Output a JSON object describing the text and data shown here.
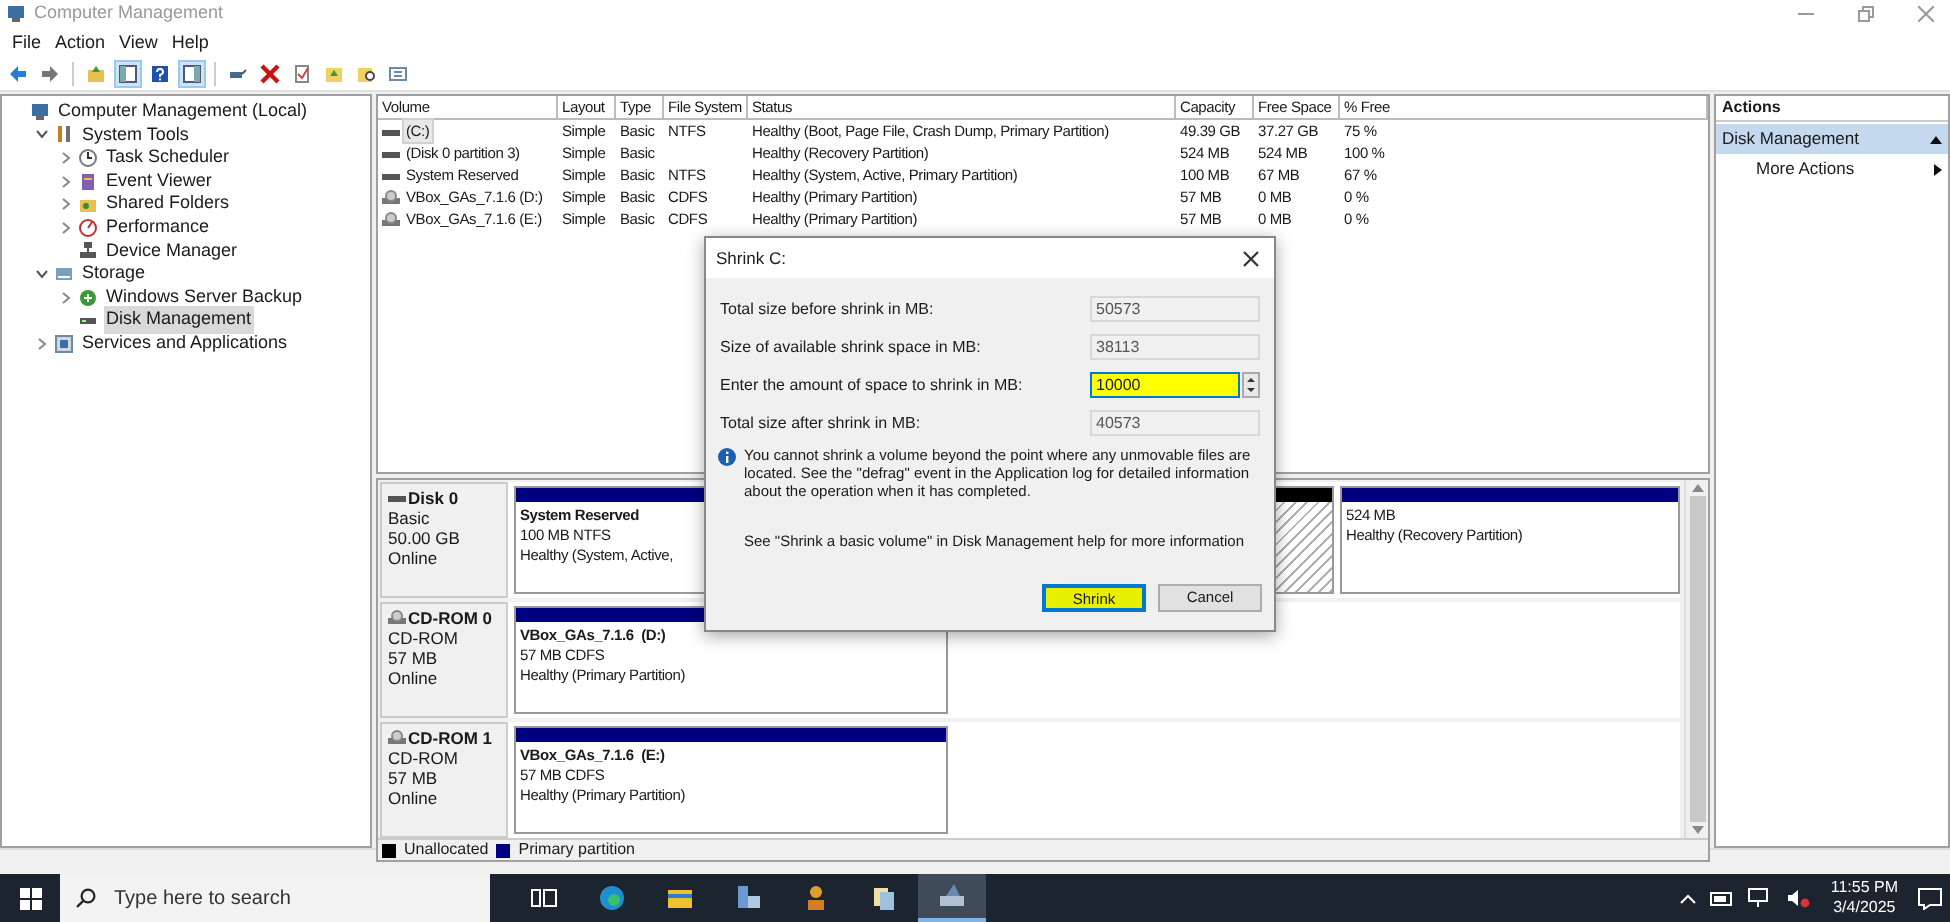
{
  "window": {
    "title": "Computer Management"
  },
  "menu": [
    "File",
    "Action",
    "View",
    "Help"
  ],
  "toolbar": [
    {
      "pressed": false
    },
    {
      "pressed": false
    },
    {
      "pressed": false
    },
    {
      "pressed": true
    },
    {
      "pressed": false
    },
    {
      "pressed": true
    },
    {
      "pressed": false
    },
    {
      "pressed": false
    },
    {
      "pressed": false
    },
    {
      "pressed": false
    },
    {
      "pressed": false
    },
    {
      "pressed": false
    }
  ],
  "tree": [
    {
      "label": "Computer Management (Local)",
      "kind": "plain",
      "selected": false,
      "children": [
        {
          "label": "System Tools",
          "kind": "node",
          "expanded": true,
          "selected": false,
          "children": [
            {
              "label": "Task Scheduler",
              "kind": "node",
              "expanded": false,
              "selected": false
            },
            {
              "label": "Event Viewer",
              "kind": "node",
              "expanded": false,
              "selected": false
            },
            {
              "label": "Shared Folders",
              "kind": "node",
              "expanded": false,
              "selected": false
            },
            {
              "label": "Performance",
              "kind": "node",
              "expanded": false,
              "selected": false
            },
            {
              "label": "Device Manager",
              "kind": "plain",
              "selected": false
            }
          ]
        },
        {
          "label": "Storage",
          "kind": "node",
          "expanded": true,
          "selected": false,
          "children": [
            {
              "label": "Windows Server Backup",
              "kind": "node",
              "expanded": false,
              "selected": false
            },
            {
              "label": "Disk Management",
              "kind": "plain",
              "selected": true
            }
          ]
        },
        {
          "label": "Services and Applications",
          "kind": "node",
          "expanded": false,
          "selected": false
        }
      ]
    }
  ],
  "volumes": {
    "columns": [
      "Volume",
      "Layout",
      "Type",
      "File System",
      "Status",
      "Capacity",
      "Free Space",
      "% Free"
    ],
    "rows": [
      {
        "kind": "disk",
        "selected": true,
        "cells": [
          "(C:)",
          "Simple",
          "Basic",
          "NTFS",
          "Healthy (Boot, Page File, Crash Dump, Primary Partition)",
          "49.39 GB",
          "37.27 GB",
          "75 %"
        ]
      },
      {
        "kind": "disk",
        "selected": false,
        "cells": [
          "(Disk 0 partition 3)",
          "Simple",
          "Basic",
          "",
          "Healthy (Recovery Partition)",
          "524 MB",
          "524 MB",
          "100 %"
        ]
      },
      {
        "kind": "disk",
        "selected": false,
        "cells": [
          "System Reserved",
          "Simple",
          "Basic",
          "NTFS",
          "Healthy (System, Active, Primary Partition)",
          "100 MB",
          "67 MB",
          "67 %"
        ]
      },
      {
        "kind": "cdrom",
        "selected": false,
        "cells": [
          "VBox_GAs_7.1.6 (D:)",
          "Simple",
          "Basic",
          "CDFS",
          "Healthy (Primary Partition)",
          "57 MB",
          "0 MB",
          "0 %"
        ]
      },
      {
        "kind": "cdrom",
        "selected": false,
        "cells": [
          "VBox_GAs_7.1.6 (E:)",
          "Simple",
          "Basic",
          "CDFS",
          "Healthy (Primary Partition)",
          "57 MB",
          "0 MB",
          "0 %"
        ]
      }
    ]
  },
  "disks": [
    {
      "kind": "disk",
      "name": "Disk 0",
      "lines": [
        "Basic",
        "50.00 GB",
        "Online"
      ],
      "partitions": [
        {
          "kind": "primary",
          "name": "System Reserved",
          "lines": [
            "100 MB NTFS",
            "Healthy (System, Active,"
          ]
        },
        {
          "kind": "unallocated"
        },
        {
          "kind": "primary",
          "lines": [
            "524 MB",
            "Healthy (Recovery Partition)"
          ]
        }
      ]
    },
    {
      "kind": "cdrom",
      "name": "CD-ROM 0",
      "lines": [
        "CD-ROM",
        "57 MB",
        "Online"
      ],
      "partitions": [
        {
          "kind": "primary",
          "name": "VBox_GAs_7.1.6  (D:)",
          "lines": [
            "57 MB CDFS",
            "Healthy (Primary Partition)"
          ]
        }
      ]
    },
    {
      "kind": "cdrom",
      "name": "CD-ROM 1",
      "lines": [
        "CD-ROM",
        "57 MB",
        "Online"
      ],
      "partitions": [
        {
          "kind": "primary",
          "name": "VBox_GAs_7.1.6  (E:)",
          "lines": [
            "57 MB CDFS",
            "Healthy (Primary Partition)"
          ]
        }
      ]
    }
  ],
  "legend": [
    {
      "label": "Unallocated",
      "color": "#000000"
    },
    {
      "label": "Primary partition",
      "color": "#000080"
    }
  ],
  "actions": {
    "title": "Actions",
    "section": "Disk Management",
    "items": [
      "More Actions"
    ]
  },
  "dialog": {
    "title": "Shrink C:",
    "fields": [
      {
        "kind": "readonly",
        "label": "Total size before shrink in MB:",
        "value": "50573"
      },
      {
        "kind": "readonly",
        "label": "Size of available shrink space in MB:",
        "value": "38113"
      },
      {
        "kind": "input",
        "label": "Enter the amount of space to shrink in MB:",
        "value": "10000",
        "highlighted": true
      },
      {
        "kind": "readonly",
        "label": "Total size after shrink in MB:",
        "value": "40573"
      }
    ],
    "info": "You cannot shrink a volume beyond the point where any unmovable files are located. See the \"defrag\" event in the Application log for detailed information about the operation when it has completed.",
    "help": "See \"Shrink a basic volume\" in Disk Management help for more information",
    "buttons": [
      {
        "label": "Shrink",
        "default": true,
        "highlighted": true
      },
      {
        "label": "Cancel",
        "default": false,
        "highlighted": false
      }
    ]
  },
  "taskbar": {
    "search_placeholder": "Type here to search",
    "apps": [
      {
        "selected": false
      },
      {
        "selected": false
      },
      {
        "selected": false
      },
      {
        "selected": false
      },
      {
        "selected": false
      },
      {
        "selected": false
      },
      {
        "selected": true
      }
    ],
    "time": "11:55 PM",
    "date": "3/4/2025"
  }
}
